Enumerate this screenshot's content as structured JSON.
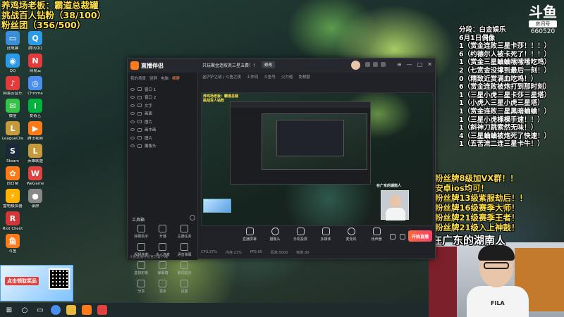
{
  "overlay": {
    "line1": "养鸡场老板：霸道总裁罐",
    "line2": "挑战百人钻粉（38/100）",
    "line3": "粉丝团（356/500）"
  },
  "room": {
    "logo": "斗鱼",
    "tag": "房间号",
    "number": "660520"
  },
  "chat": {
    "lines": [
      "分段：白金娱乐",
      "6月1日偶像",
      "1（赏金连败三星卡莎！！！）",
      "6（约德尔人被卡死了！！！）",
      "1（赏金三星蛐蛐嗦嗦嗦吃鸡）",
      "2（七赏金没撑到最后一刻！）",
      "0（精致近赏满血吃鸡！）",
      "6（赏金连败被炮打到那时刻）",
      "1（三星小虎三星卡莎三星塔）",
      "1（小虎入三星小虎三星塔）",
      "1（赏金连败三星黑暗蛐蛐！）",
      "1（三星小虎棵棵手速！！）",
      "1（斜神刀跳索然无味！）",
      "4（三星蛐蛐被炮死了快速！）",
      "1（五苦流二连三星卡牛！）"
    ]
  },
  "fan_notes": {
    "lines": [
      "粉丝牌8级加VX群！！",
      "安卓ios均可！",
      "粉丝牌13级紫服劫后！！",
      "粉丝牌16级赛季大师！",
      "粉丝牌21级赛季王者！",
      "粉丝牌21级入上神鼓！"
    ]
  },
  "location_caption": "在广东的湖南人",
  "webcam": {
    "shirt_logo": "FILA"
  },
  "desktop_icons": [
    {
      "label": "此电脑",
      "color": "#3b8fd9",
      "glyph": "▭"
    },
    {
      "label": "QQ",
      "color": "#2d9ae6",
      "glyph": "◉"
    },
    {
      "label": "网易云音乐",
      "color": "#e23b3b",
      "glyph": "♪"
    },
    {
      "label": "微信",
      "color": "#34c248",
      "glyph": "✉"
    },
    {
      "label": "LeagueClient",
      "color": "#c49a3c",
      "glyph": "L"
    },
    {
      "label": "Steam",
      "color": "#1b2838",
      "glyph": "S"
    },
    {
      "label": "向日葵",
      "color": "#ff7a18",
      "glyph": "✿"
    },
    {
      "label": "雷电模拟器",
      "color": "#ffb300",
      "glyph": "⚡"
    },
    {
      "label": "Riot Client",
      "color": "#d13639",
      "glyph": "R"
    },
    {
      "label": "斗鱼",
      "color": "#ff7a18",
      "glyph": "鱼"
    }
  ],
  "desktop_icons_col2": [
    {
      "label": "腾讯QQ",
      "color": "#2d9ae6",
      "glyph": "Q"
    },
    {
      "label": "网易云",
      "color": "#e23b3b",
      "glyph": "N"
    },
    {
      "label": "Chrome",
      "color": "#4a8ef0",
      "glyph": "◎"
    },
    {
      "label": "爱奇艺",
      "color": "#00b33c",
      "glyph": "i"
    },
    {
      "label": "腾讯视频",
      "color": "#ff7a18",
      "glyph": "▶"
    },
    {
      "label": "英雄联盟",
      "color": "#c49a3c",
      "glyph": "L"
    },
    {
      "label": "WeGame",
      "color": "#e2423d",
      "glyph": "W"
    },
    {
      "label": "录屏",
      "color": "#888888",
      "glyph": "●"
    }
  ],
  "ad": {
    "title": "点击领取奖品"
  },
  "app": {
    "title": "直播伴侣",
    "room_title": "只玩聚金连败英三星五费！！",
    "edit_label": "修改",
    "subbar": [
      "金铲铲之战 | 斗鱼之夜",
      "工作间",
      "斗鱼号",
      "火力值",
      "免税额"
    ],
    "left_tabs": [
      "我的场景",
      "竖屏",
      "电脑",
      "横屏"
    ],
    "scenes": [
      "窗口 1",
      "窗口 2",
      "文字",
      "画面",
      "图片",
      "画中画",
      "图片",
      "摄像头"
    ],
    "tools_header": "工具箱",
    "tools": [
      "弹幕助手",
      "开播",
      "主播任务",
      "视频连麦",
      "多人连麦",
      "语音弹幕",
      "虚拟形象",
      "弹幕墙",
      "歌词显示",
      "分享",
      "更多",
      "设置"
    ],
    "footer": "斗鱼直播伴侣官方客户端",
    "bottom_tools": [
      "直播屏幕",
      "摄像头",
      "手机投屏",
      "多媒体",
      "麦克风",
      "扬声器"
    ],
    "start_live": "开始直播",
    "status": [
      "CPU:27%",
      "内存:21%",
      "FPS:60",
      "码率:5000",
      "帧率:30"
    ]
  },
  "preview": {
    "overlay_line1": "养鸡场老板：霸道总裁",
    "overlay_line2": "挑战百人钻粉",
    "fan_line": "在广东的湖南人"
  }
}
